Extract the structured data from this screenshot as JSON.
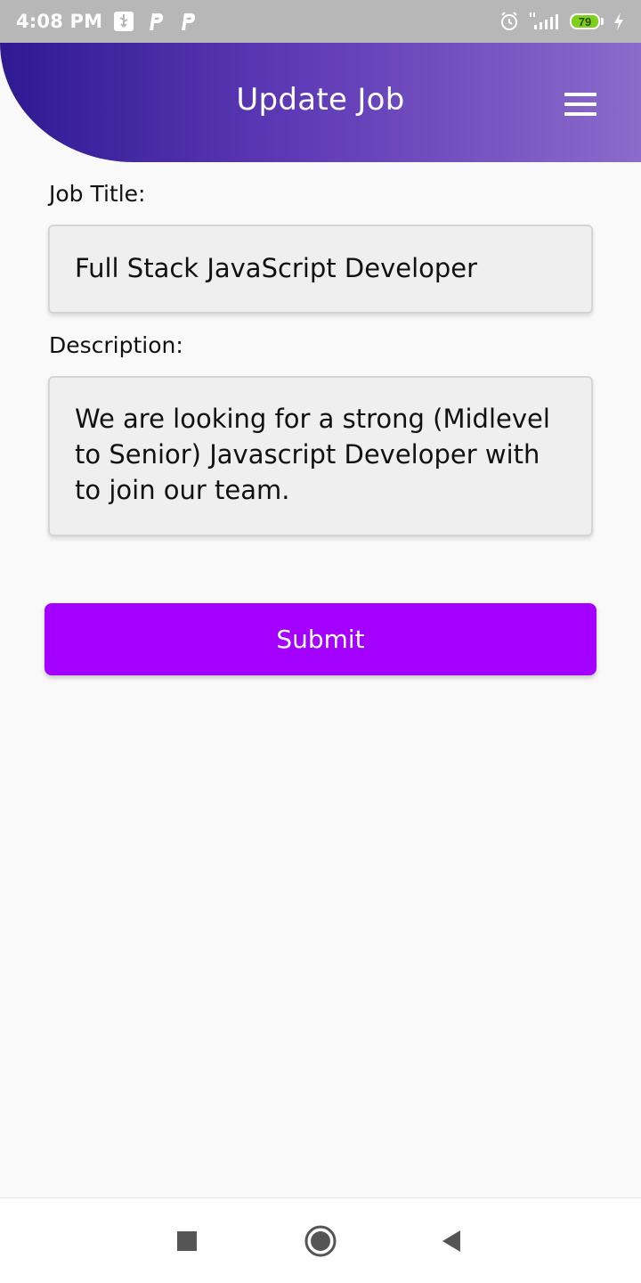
{
  "status_bar": {
    "time": "4:08 PM",
    "battery_level": "79",
    "battery_color": "#7fcf1e",
    "icons": [
      "usb-icon",
      "parking-icon",
      "parking-icon",
      "alarm-icon",
      "signal-icon",
      "battery-icon",
      "charging-icon"
    ]
  },
  "header": {
    "title": "Update Job",
    "menu_icon": "hamburger-menu-icon",
    "gradient_colors": [
      "#2e1a92",
      "#8b6bcb"
    ]
  },
  "form": {
    "job_title_label": "Job Title:",
    "job_title_value": "Full Stack JavaScript Developer",
    "description_label": "Description:",
    "description_value": "We are looking for a strong (Midlevel to Senior) Javascript Developer with to join our team."
  },
  "actions": {
    "submit_label": "Submit",
    "submit_color": "#a400ff"
  },
  "navigation": {
    "icons": [
      "recent-apps-icon",
      "home-icon",
      "back-icon"
    ]
  }
}
